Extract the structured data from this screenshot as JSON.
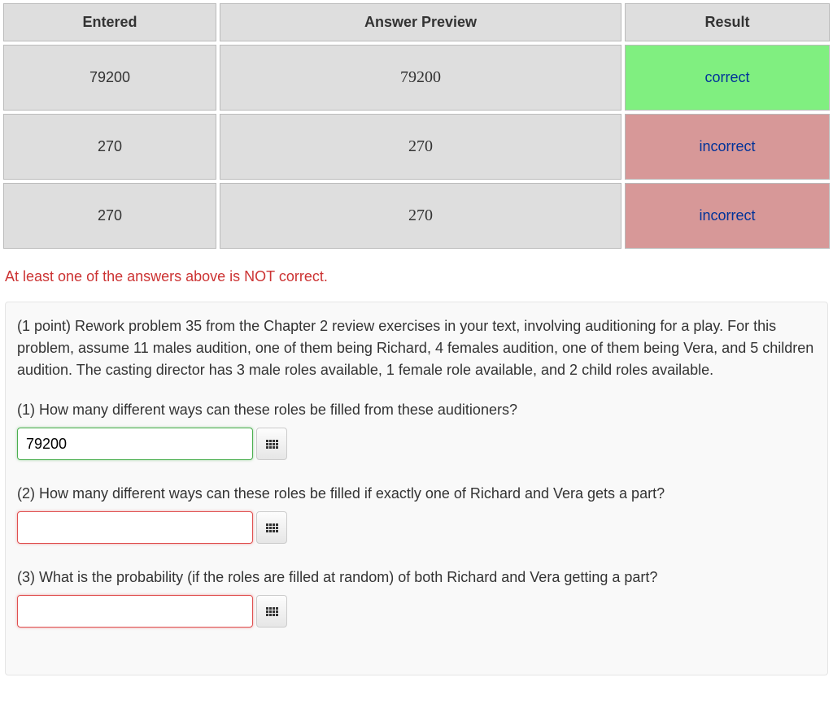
{
  "table": {
    "headers": {
      "entered": "Entered",
      "preview": "Answer Preview",
      "result": "Result"
    },
    "rows": [
      {
        "entered": "79200",
        "preview": "79200",
        "result": "correct",
        "status": "correct"
      },
      {
        "entered": "270",
        "preview": "270",
        "result": "incorrect",
        "status": "incorrect"
      },
      {
        "entered": "270",
        "preview": "270",
        "result": "incorrect",
        "status": "incorrect"
      }
    ]
  },
  "error_message": "At least one of the answers above is NOT correct.",
  "problem": {
    "intro": "(1 point) Rework problem 35 from the Chapter 2 review exercises in your text, involving auditioning for a play. For this problem, assume 11 males audition, one of them being Richard, 4 females audition, one of them being Vera, and 5 children audition. The casting director has 3 male roles available, 1 female role available, and 2 child roles available.",
    "questions": [
      {
        "prompt": "(1) How many different ways can these roles be filled from these auditioners?",
        "value": "79200",
        "status": "correct"
      },
      {
        "prompt": "(2) How many different ways can these roles be filled if exactly one of Richard and Vera gets a part?",
        "value": "",
        "status": "incorrect"
      },
      {
        "prompt": "(3) What is the probability (if the roles are filled at random) of both Richard and Vera getting a part?",
        "value": "",
        "status": "incorrect"
      }
    ]
  }
}
